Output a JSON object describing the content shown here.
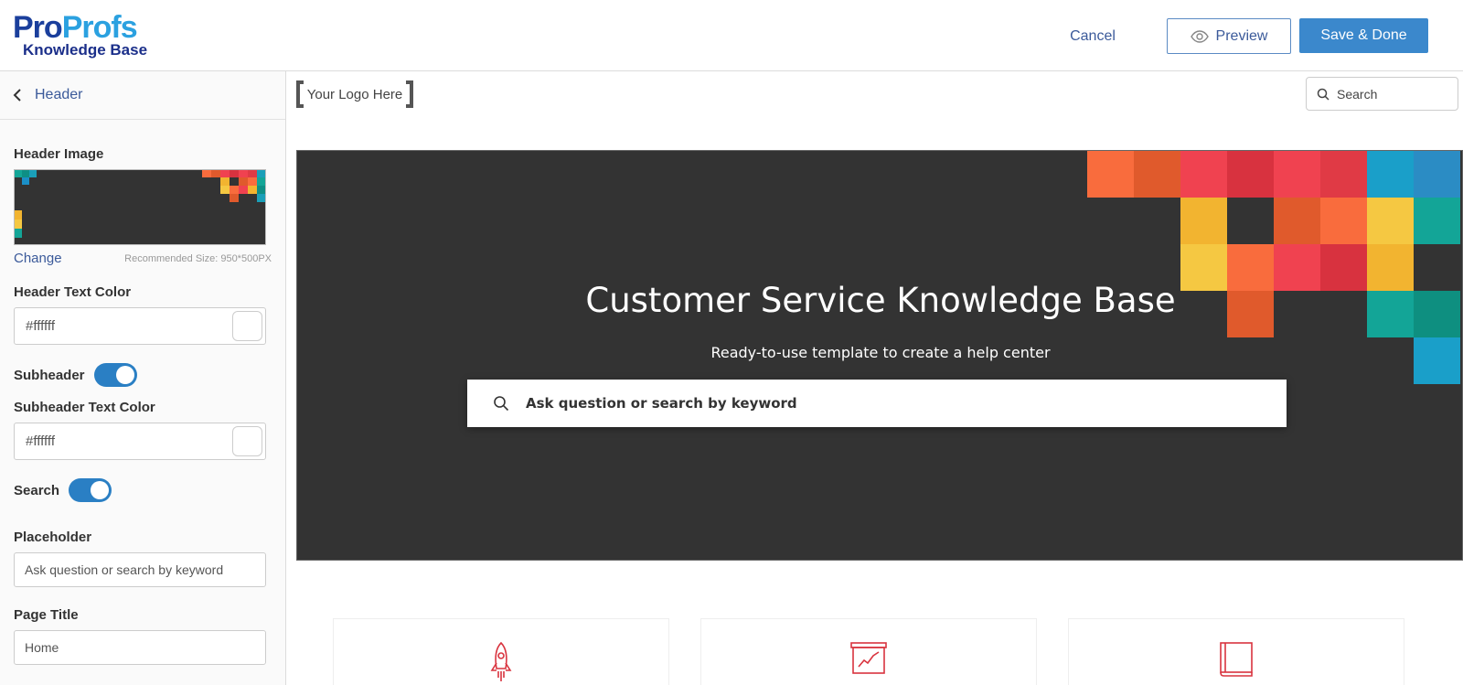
{
  "brand": {
    "logo_part1": "Pro",
    "logo_part2": "Profs",
    "logo_sub": "Knowledge Base"
  },
  "topbar": {
    "cancel_label": "Cancel",
    "preview_label": "Preview",
    "save_label": "Save & Done"
  },
  "sidebar": {
    "back_label": "Header",
    "header_image_label": "Header Image",
    "change_label": "Change",
    "recommended_size": "Recommended Size: 950*500PX",
    "header_text_color_label": "Header Text Color",
    "header_text_color_value": "#ffffff",
    "subheader_label": "Subheader",
    "subheader_text_color_label": "Subheader Text Color",
    "subheader_text_color_value": "#ffffff",
    "search_label": "Search",
    "placeholder_label": "Placeholder",
    "placeholder_value": "Ask question or search by keyword",
    "page_title_label": "Page Title",
    "page_title_value": "Home"
  },
  "preview": {
    "logo_placeholder": "Your Logo Here",
    "top_search_label": "Search",
    "banner_title": "Customer Service Knowledge Base",
    "banner_subtitle": "Ready-to-use template to create a help center",
    "banner_search_placeholder": "Ask question or search by keyword"
  },
  "colors": {
    "accent": "#3b88cc",
    "link": "#3b5a9a",
    "banner_bg": "#333333",
    "card_icon": "#d9343f"
  },
  "icons": {
    "card_1": "rocket-icon",
    "card_2": "presentation-chart-icon",
    "card_3": "book-icon"
  }
}
